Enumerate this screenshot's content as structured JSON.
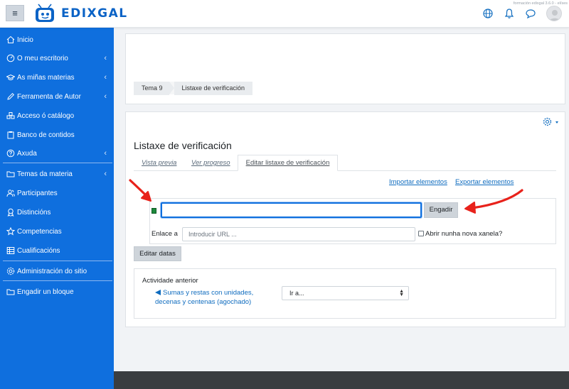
{
  "header": {
    "logo_text": "EDIXGAL",
    "version": "formación edixgal 3.6.0 - el/ses",
    "menu_glyph": "≡"
  },
  "sidebar": {
    "items": [
      {
        "label": "Inicio",
        "icon": "home-icon"
      },
      {
        "label": "O meu escritorio",
        "icon": "dashboard-icon",
        "chevron": true
      },
      {
        "label": "As miñas materias",
        "icon": "graduation-cap-icon",
        "chevron": true
      },
      {
        "label": "Ferramenta de Autor",
        "icon": "pencil-icon",
        "chevron": true
      },
      {
        "label": "Acceso ó catálogo",
        "icon": "catalog-icon"
      },
      {
        "label": "Banco de contidos",
        "icon": "clipboard-icon"
      },
      {
        "label": "Axuda",
        "icon": "help-icon",
        "chevron": true
      },
      {
        "label": "Temas da materia",
        "icon": "folder-icon",
        "chevron": true
      },
      {
        "label": "Participantes",
        "icon": "users-icon"
      },
      {
        "label": "Distincións",
        "icon": "award-icon"
      },
      {
        "label": "Competencias",
        "icon": "star-icon"
      },
      {
        "label": "Cualificacións",
        "icon": "grades-icon"
      },
      {
        "label": "Administración do sitio",
        "icon": "gear-icon"
      },
      {
        "label": "Engadir un bloque",
        "icon": "add-block-icon"
      }
    ],
    "chevron_glyph": "‹"
  },
  "breadcrumb": [
    "Tema 9",
    "Listaxe de verificación"
  ],
  "page": {
    "title": "Listaxe de verificación",
    "tabs": [
      "Vista previa",
      "Ver progreso",
      "Editar listaxe de verificación"
    ],
    "import_link": "Importar elementos",
    "export_link": "Exportar elementos",
    "item_input_value": "",
    "add_button": "Engadir",
    "link_label": "Enlace a",
    "url_placeholder": "Introducir URL ...",
    "new_window_label": "Abrir nunha nova xanela?",
    "edit_dates_button": "Editar datas",
    "activity_title": "Actividade anterior",
    "activity_link": "Sumas y restas con unidades, decenas y centenas (agochado)",
    "jump_select": "Ir a...",
    "select_caret": "▲▼"
  },
  "colors": {
    "sidebar": "#0f6fde",
    "link": "#0f6cbf",
    "annotation_arrow": "#e8221b"
  }
}
